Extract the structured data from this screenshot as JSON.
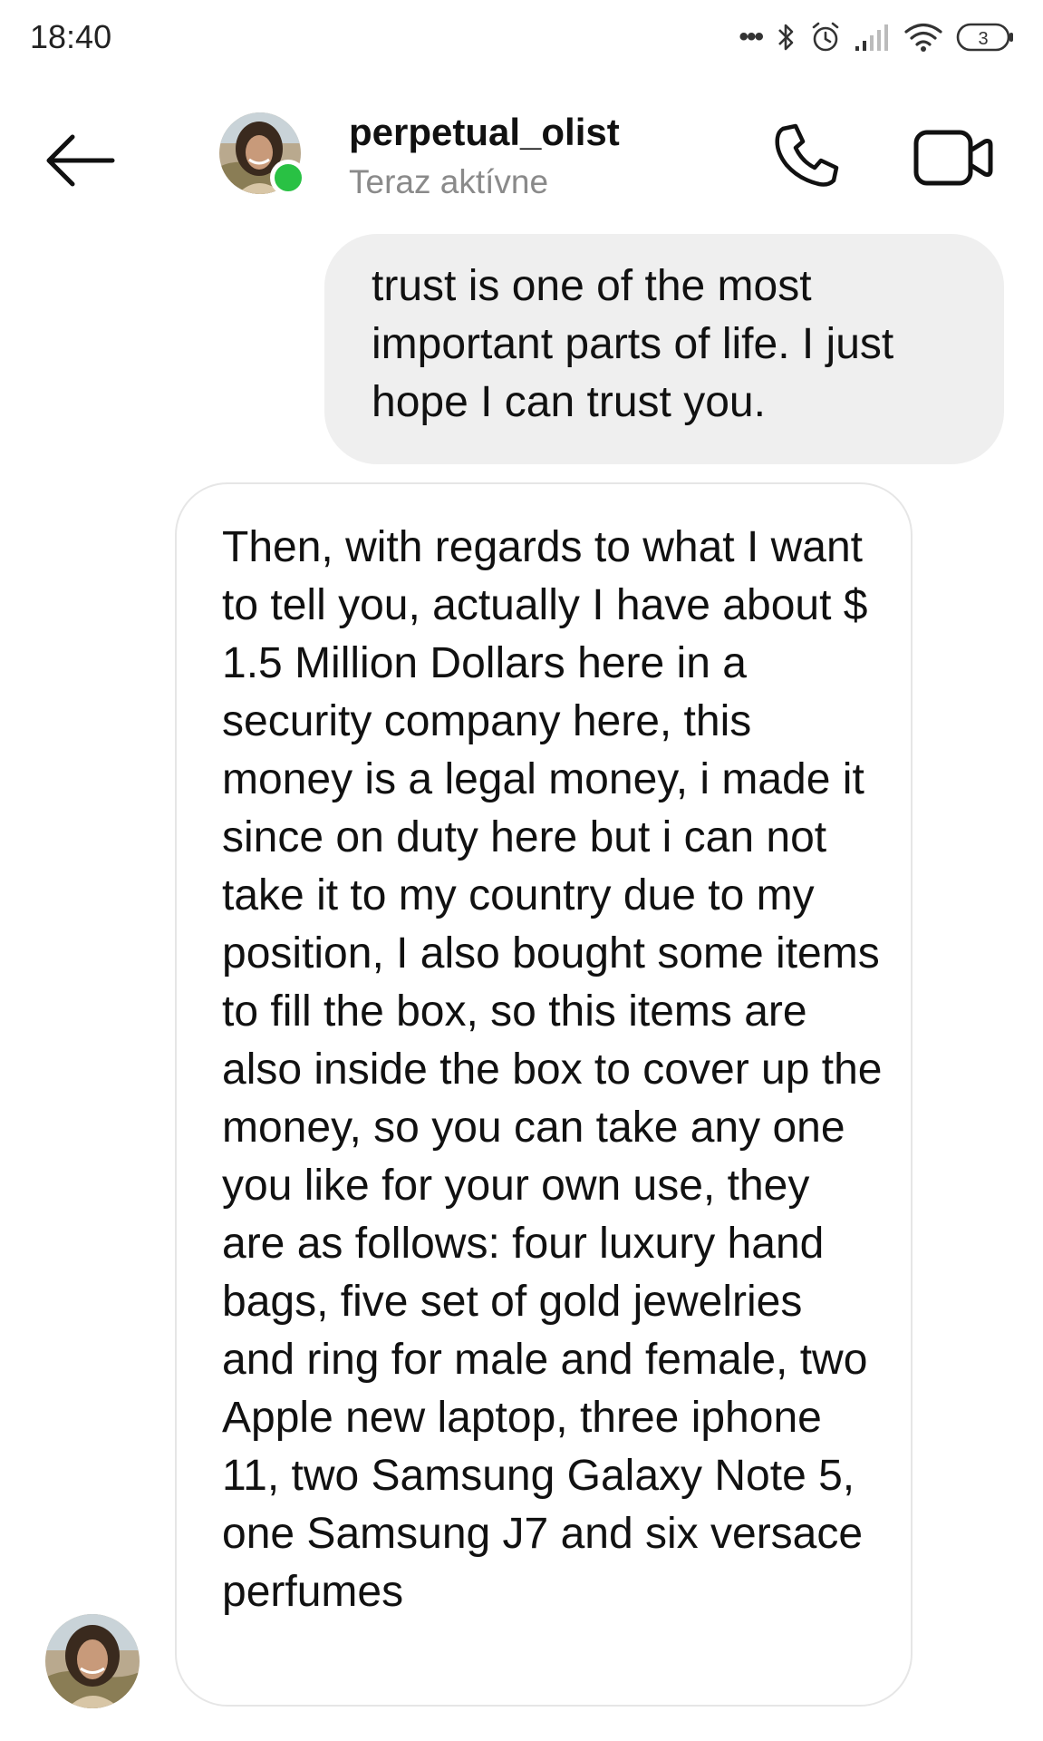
{
  "status_bar": {
    "time": "18:40",
    "more_indicator": "•••",
    "icons": [
      "bluetooth-icon",
      "alarm-icon",
      "signal-icon",
      "wifi-icon",
      "battery-icon"
    ],
    "battery_level": "3"
  },
  "header": {
    "back_icon": "arrow-left-icon",
    "username": "perpetual_olist",
    "presence": "Teraz aktívne",
    "online": true,
    "call_icon": "phone-icon",
    "video_icon": "video-camera-icon"
  },
  "messages": [
    {
      "direction": "sent",
      "text": "trust is one of the most important parts of life. I just hope I can trust you."
    },
    {
      "direction": "received",
      "text": "Then, with regards to what I want to tell you, actually I have about $ 1.5 Million Dollars here in a security company here, this money is a legal money, i made it since on duty here but i can not take it to my country due to my position, I also bought some items to fill the box, so this items are also inside the box to cover up the money, so you can take any one you like for your own use, they are as follows: four luxury hand bags, five set of gold jewelries and ring for male and female, two Apple new laptop, three iphone 11, two Samsung Galaxy Note 5, one Samsung J7 and six versace perfumes"
    }
  ],
  "colors": {
    "online_dot": "#29c144",
    "sent_bubble": "#efefef",
    "received_border": "#e6e6e6",
    "secondary_text": "#8a8a8a"
  }
}
